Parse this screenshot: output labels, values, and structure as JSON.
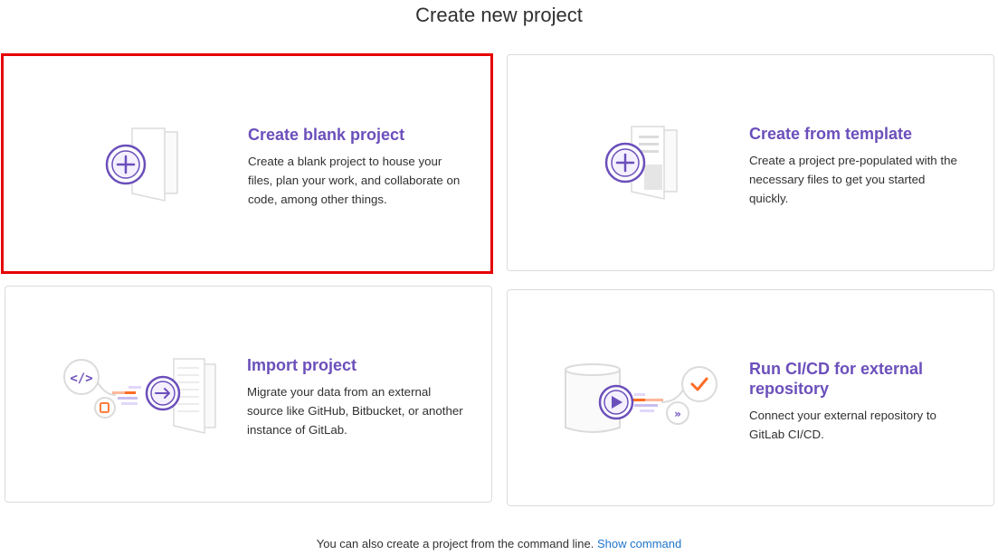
{
  "page": {
    "title": "Create new project"
  },
  "cards": {
    "blank": {
      "title": "Create blank project",
      "description": "Create a blank project to house your files, plan your work, and collaborate on code, among other things."
    },
    "template": {
      "title": "Create from template",
      "description": "Create a project pre-populated with the necessary files to get you started quickly."
    },
    "import": {
      "title": "Import project",
      "description": "Migrate your data from an external source like GitHub, Bitbucket, or another instance of GitLab."
    },
    "cicd": {
      "title": "Run CI/CD for external repository",
      "description": "Connect your external repository to GitLab CI/CD."
    }
  },
  "footer": {
    "text": "You can also create a project from the command line.",
    "link": "Show command"
  },
  "colors": {
    "accent": "#6b4fbb",
    "selection": "#e60000",
    "link": "#1f75cb",
    "orange": "#e24329"
  }
}
